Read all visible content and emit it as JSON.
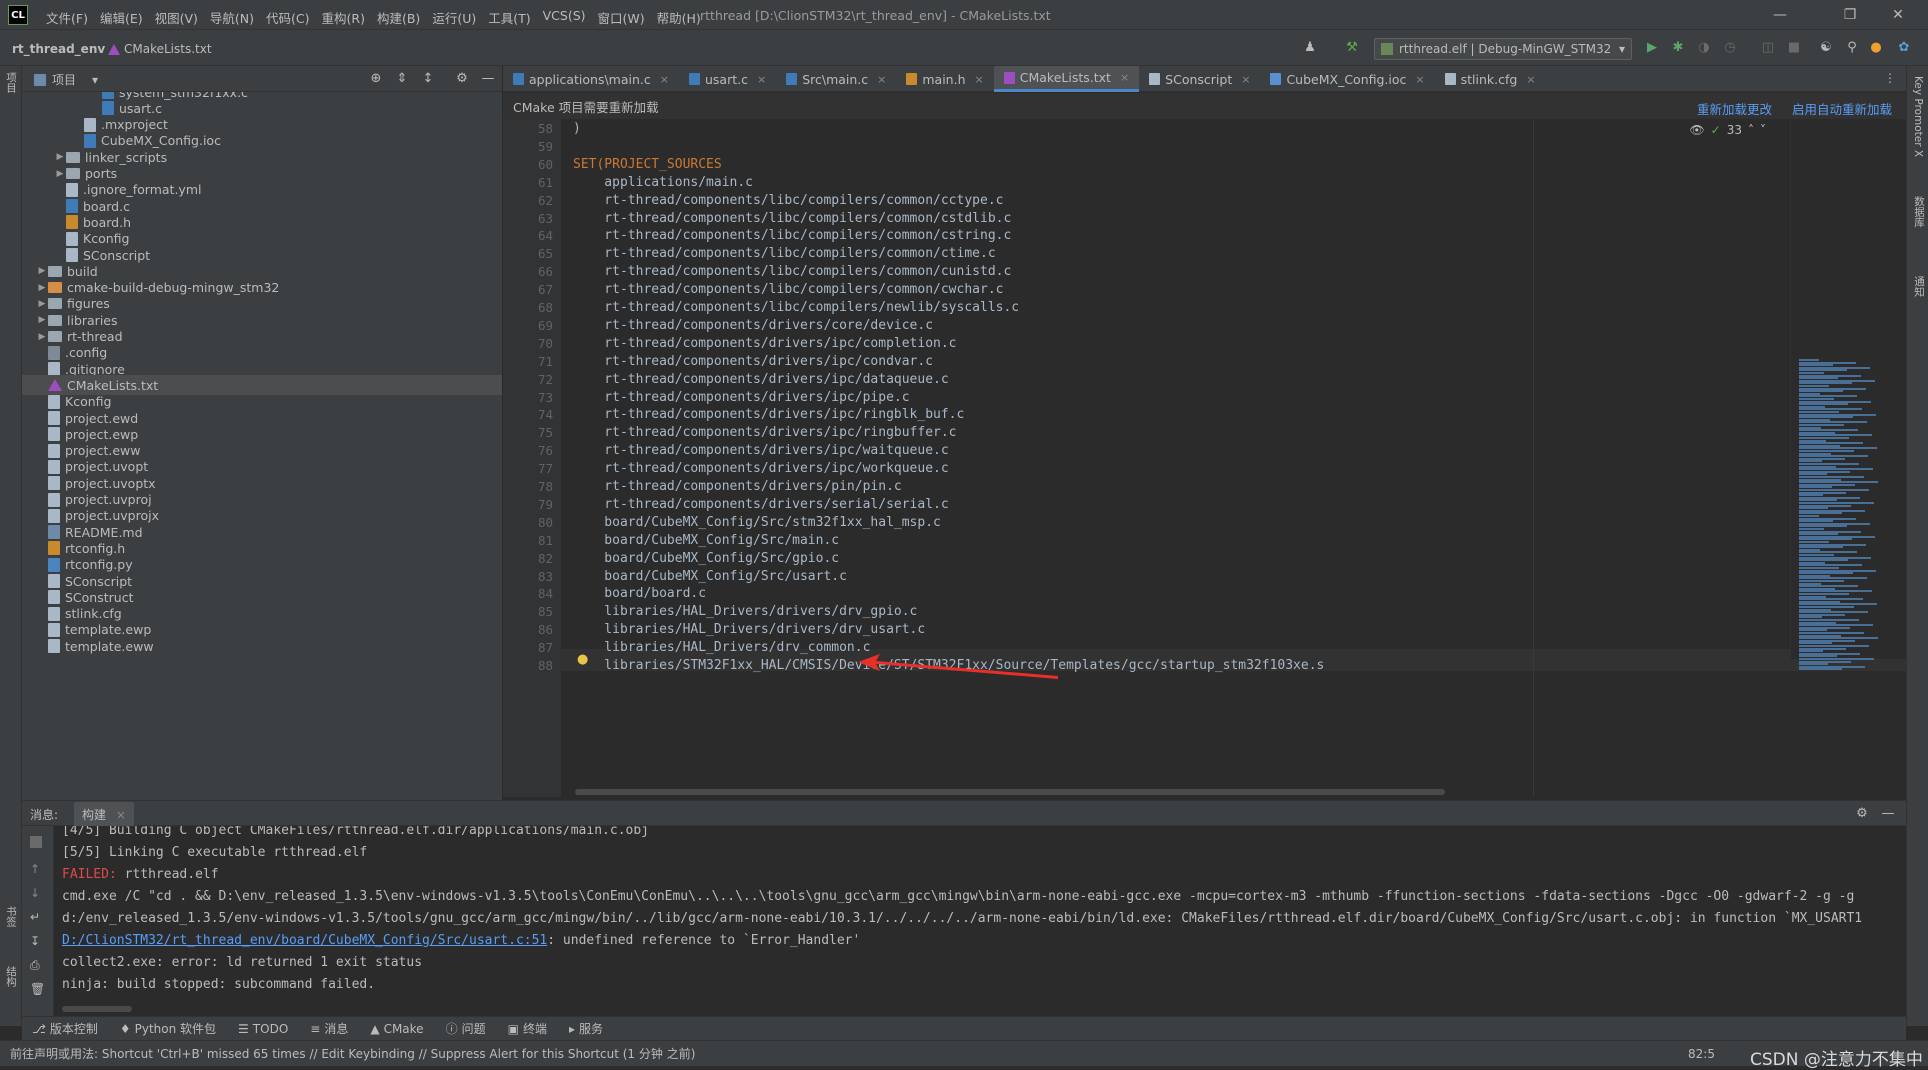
{
  "app": {
    "logo": "CL",
    "menu": [
      "文件(F)",
      "编辑(E)",
      "视图(V)",
      "导航(N)",
      "代码(C)",
      "重构(R)",
      "构建(B)",
      "运行(U)",
      "工具(T)",
      "VCS(S)",
      "窗口(W)",
      "帮助(H)"
    ],
    "window_title": "rtthread [D:\\ClionSTM32\\rt_thread_env] - CMakeLists.txt"
  },
  "navbar": {
    "project": "rt_thread_env",
    "file": "CMakeLists.txt",
    "run_config": "rtthread.elf | Debug-MinGW_STM32"
  },
  "project_panel": {
    "title": "项目",
    "items": [
      {
        "label": "system_stm32f1xx.c",
        "icon": "c-file-icon",
        "indent": 4
      },
      {
        "label": "usart.c",
        "icon": "c-file-icon",
        "indent": 4
      },
      {
        "label": ".mxproject",
        "icon": "file-icon",
        "indent": 3
      },
      {
        "label": "CubeMX_Config.ioc",
        "icon": "ioc-file-icon",
        "indent": 3
      },
      {
        "label": "linker_scripts",
        "icon": "folder-icon",
        "indent": 2,
        "arrow": true
      },
      {
        "label": "ports",
        "icon": "folder-icon",
        "indent": 2,
        "arrow": true
      },
      {
        "label": ".ignore_format.yml",
        "icon": "file-icon",
        "indent": 2
      },
      {
        "label": "board.c",
        "icon": "c-file-icon",
        "indent": 2
      },
      {
        "label": "board.h",
        "icon": "h-file-icon",
        "indent": 2
      },
      {
        "label": "Kconfig",
        "icon": "file-icon",
        "indent": 2
      },
      {
        "label": "SConscript",
        "icon": "file-icon",
        "indent": 2
      },
      {
        "label": "build",
        "icon": "folder-icon",
        "indent": 1,
        "arrow": true
      },
      {
        "label": "cmake-build-debug-mingw_stm32",
        "icon": "folder-orange-icon",
        "indent": 1,
        "arrow": true
      },
      {
        "label": "figures",
        "icon": "folder-icon",
        "indent": 1,
        "arrow": true
      },
      {
        "label": "libraries",
        "icon": "folder-icon",
        "indent": 1,
        "arrow": true
      },
      {
        "label": "rt-thread",
        "icon": "folder-icon",
        "indent": 1,
        "arrow": true
      },
      {
        "label": ".config",
        "icon": "cfg-file-icon",
        "indent": 1
      },
      {
        "label": ".gitignore",
        "icon": "file-icon",
        "indent": 1
      },
      {
        "label": "CMakeLists.txt",
        "icon": "cmake-icon",
        "indent": 1,
        "selected": true
      },
      {
        "label": "Kconfig",
        "icon": "file-icon",
        "indent": 1
      },
      {
        "label": "project.ewd",
        "icon": "file-icon",
        "indent": 1
      },
      {
        "label": "project.ewp",
        "icon": "file-icon",
        "indent": 1
      },
      {
        "label": "project.eww",
        "icon": "file-icon",
        "indent": 1
      },
      {
        "label": "project.uvopt",
        "icon": "file-icon",
        "indent": 1
      },
      {
        "label": "project.uvoptx",
        "icon": "file-icon",
        "indent": 1
      },
      {
        "label": "project.uvproj",
        "icon": "file-icon",
        "indent": 1
      },
      {
        "label": "project.uvprojx",
        "icon": "file-icon",
        "indent": 1
      },
      {
        "label": "README.md",
        "icon": "md-file-icon",
        "indent": 1
      },
      {
        "label": "rtconfig.h",
        "icon": "h-file-icon",
        "indent": 1
      },
      {
        "label": "rtconfig.py",
        "icon": "py-file-icon",
        "indent": 1
      },
      {
        "label": "SConscript",
        "icon": "file-icon",
        "indent": 1
      },
      {
        "label": "SConstruct",
        "icon": "file-icon",
        "indent": 1
      },
      {
        "label": "stlink.cfg",
        "icon": "file-icon",
        "indent": 1
      },
      {
        "label": "template.ewp",
        "icon": "file-icon",
        "indent": 1
      },
      {
        "label": "template.eww",
        "icon": "file-icon",
        "indent": 1
      }
    ]
  },
  "tabs": [
    {
      "label": "applications\\main.c",
      "color": "#3f7bb8"
    },
    {
      "label": "usart.c",
      "color": "#3f7bb8"
    },
    {
      "label": "Src\\main.c",
      "color": "#3f7bb8"
    },
    {
      "label": "main.h",
      "color": "#c88a2c"
    },
    {
      "label": "CMakeLists.txt",
      "color": "#9e4dbf",
      "active": true
    },
    {
      "label": "SConscript",
      "color": "#a9b7c6"
    },
    {
      "label": "CubeMX_Config.ioc",
      "color": "#5a8fd0"
    },
    {
      "label": "stlink.cfg",
      "color": "#a9b7c6"
    }
  ],
  "notice": {
    "text": "CMake 项目需要重新加载",
    "reload": "重新加载更改",
    "auto_reload": "启用自动重新加载"
  },
  "inspection": {
    "count": "33"
  },
  "code_lines": [
    {
      "n": "58",
      "text": ")"
    },
    {
      "n": "59",
      "text": ""
    },
    {
      "n": "60",
      "text": "SET(PROJECT_SOURCES",
      "kw": true
    },
    {
      "n": "61",
      "text": "    applications/main.c"
    },
    {
      "n": "62",
      "text": "    rt-thread/components/libc/compilers/common/cctype.c"
    },
    {
      "n": "63",
      "text": "    rt-thread/components/libc/compilers/common/cstdlib.c"
    },
    {
      "n": "64",
      "text": "    rt-thread/components/libc/compilers/common/cstring.c"
    },
    {
      "n": "65",
      "text": "    rt-thread/components/libc/compilers/common/ctime.c"
    },
    {
      "n": "66",
      "text": "    rt-thread/components/libc/compilers/common/cunistd.c"
    },
    {
      "n": "67",
      "text": "    rt-thread/components/libc/compilers/common/cwchar.c"
    },
    {
      "n": "68",
      "text": "    rt-thread/components/libc/compilers/newlib/syscalls.c"
    },
    {
      "n": "69",
      "text": "    rt-thread/components/drivers/core/device.c"
    },
    {
      "n": "70",
      "text": "    rt-thread/components/drivers/ipc/completion.c"
    },
    {
      "n": "71",
      "text": "    rt-thread/components/drivers/ipc/condvar.c"
    },
    {
      "n": "72",
      "text": "    rt-thread/components/drivers/ipc/dataqueue.c"
    },
    {
      "n": "73",
      "text": "    rt-thread/components/drivers/ipc/pipe.c"
    },
    {
      "n": "74",
      "text": "    rt-thread/components/drivers/ipc/ringblk_buf.c"
    },
    {
      "n": "75",
      "text": "    rt-thread/components/drivers/ipc/ringbuffer.c"
    },
    {
      "n": "76",
      "text": "    rt-thread/components/drivers/ipc/waitqueue.c"
    },
    {
      "n": "77",
      "text": "    rt-thread/components/drivers/ipc/workqueue.c"
    },
    {
      "n": "78",
      "text": "    rt-thread/components/drivers/pin/pin.c"
    },
    {
      "n": "79",
      "text": "    rt-thread/components/drivers/serial/serial.c"
    },
    {
      "n": "80",
      "text": "    board/CubeMX_Config/Src/stm32f1xx_hal_msp.c"
    },
    {
      "n": "81",
      "text": "    board/CubeMX_Config/Src/main.c"
    },
    {
      "n": "82",
      "text": "    board/CubeMX_Config/Src/gpio.c"
    },
    {
      "n": "83",
      "text": "    board/CubeMX_Config/Src/usart.c"
    },
    {
      "n": "84",
      "text": "    board/board.c"
    },
    {
      "n": "85",
      "text": "    libraries/HAL_Drivers/drivers/drv_gpio.c"
    },
    {
      "n": "86",
      "text": "    libraries/HAL_Drivers/drivers/drv_usart.c"
    },
    {
      "n": "87",
      "text": "    libraries/HAL_Drivers/drv_common.c"
    },
    {
      "n": "88",
      "text": "    libraries/STM32F1xx_HAL/CMSIS/Device/ST/STM32F1xx/Source/Templates/gcc/startup_stm32f103xe.s"
    }
  ],
  "bottom_panel": {
    "tab_messages": "消息:",
    "tab_build": "构建",
    "lines": [
      "[4/5] Building C object CMakeFiles/rtthread.elf.dir/applications/main.c.obj",
      "[5/5] Linking C executable rtthread.elf",
      "rtthread.elf",
      "cmd.exe /C \"cd . && D:\\env_released_1.3.5\\env-windows-v1.3.5\\tools\\ConEmu\\ConEmu\\..\\..\\..\\tools\\gnu_gcc\\arm_gcc\\mingw\\bin\\arm-none-eabi-gcc.exe -mcpu=cortex-m3 -mthumb -ffunction-sections -fdata-sections -Dgcc -O0 -gdwarf-2 -g -g",
      "d:/env_released_1.3.5/env-windows-v1.3.5/tools/gnu_gcc/arm_gcc/mingw/bin/../lib/gcc/arm-none-eabi/10.3.1/../../../../arm-none-eabi/bin/ld.exe: CMakeFiles/rtthread.elf.dir/board/CubeMX_Config/Src/usart.c.obj: in function `MX_USART1",
      ": undefined reference to `Error_Handler'",
      "collect2.exe: error: ld returned 1 exit status",
      "ninja: build stopped: subcommand failed."
    ],
    "failed_label": "FAILED:",
    "link_text": "D:/ClionSTM32/rt_thread_env/board/CubeMX_Config/Src/usart.c:51"
  },
  "tool_tabs": [
    "版本控制",
    "Python 软件包",
    "TODO",
    "消息",
    "CMake",
    "问题",
    "终端",
    "服务"
  ],
  "status": {
    "message": "前往声明或用法: Shortcut 'Ctrl+B' missed 65 times // Edit Keybinding // Suppress Alert for this Shortcut (1 分钟 之前)",
    "position": "82:5",
    "watermark": "CSDN @注意力不集中"
  },
  "right_strip": [
    "Key Promoter X",
    "数据库",
    "通知"
  ],
  "left_strip": [
    "项目",
    "书签",
    "结构"
  ]
}
